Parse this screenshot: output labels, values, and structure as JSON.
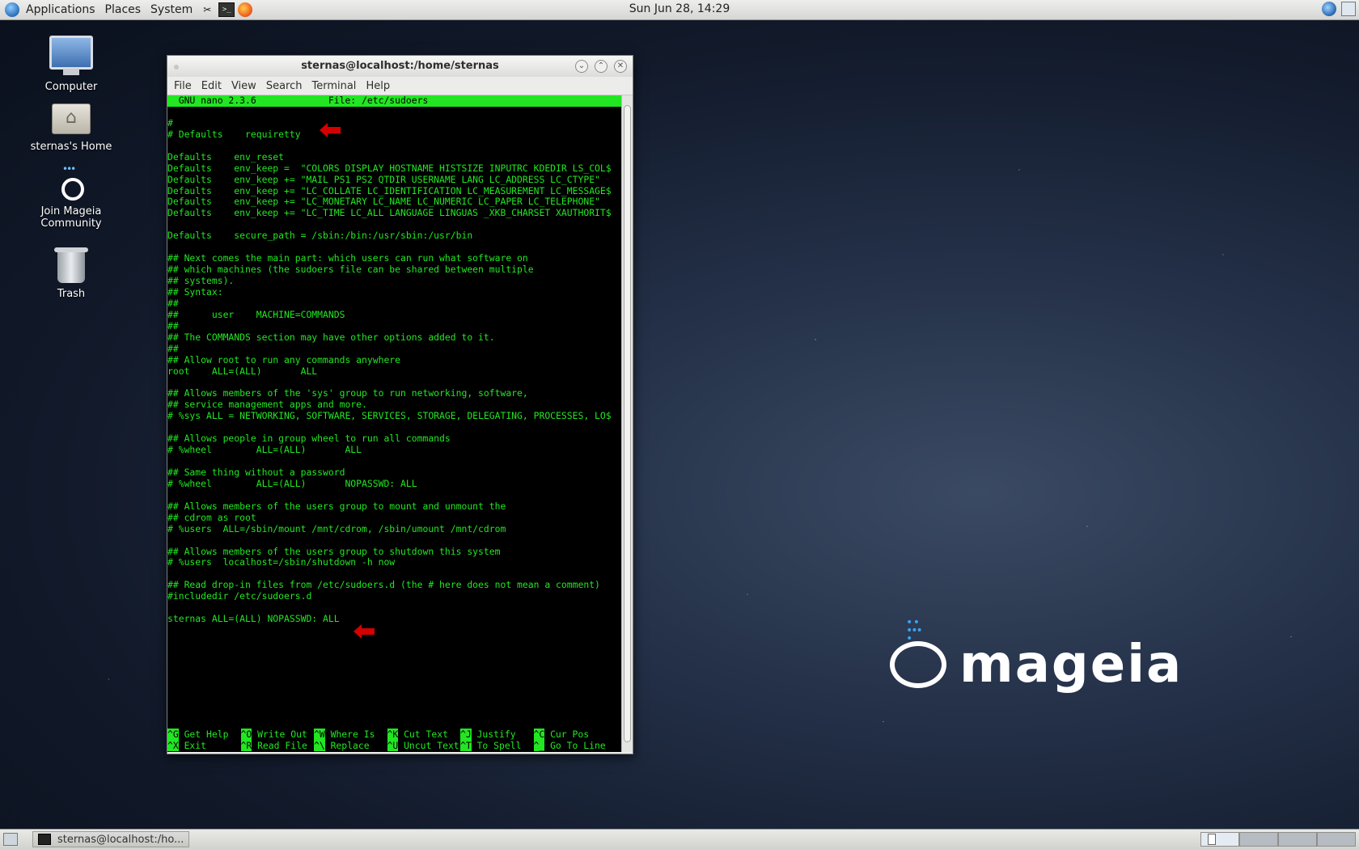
{
  "top_panel": {
    "menus": [
      "Applications",
      "Places",
      "System"
    ],
    "clock": "Sun Jun 28, 14:29"
  },
  "desktop_icons": [
    {
      "label": "Computer",
      "icon": "computer-icon"
    },
    {
      "label": "sternas's Home",
      "icon": "home-folder-icon"
    },
    {
      "label": "Join Mageia Community",
      "icon": "mageia-community-icon"
    },
    {
      "label": "Trash",
      "icon": "trash-icon"
    }
  ],
  "logo": {
    "text": "mageia"
  },
  "window": {
    "title": "sternas@localhost:/home/sternas",
    "menu": [
      "File",
      "Edit",
      "View",
      "Search",
      "Terminal",
      "Help"
    ]
  },
  "nano": {
    "header": "  GNU nano 2.3.6             File: /etc/sudoers",
    "lines": [
      "",
      "#",
      "# Defaults    requiretty",
      "",
      "Defaults    env_reset",
      "Defaults    env_keep =  \"COLORS DISPLAY HOSTNAME HISTSIZE INPUTRC KDEDIR LS_COL$",
      "Defaults    env_keep += \"MAIL PS1 PS2 QTDIR USERNAME LANG LC_ADDRESS LC_CTYPE\"",
      "Defaults    env_keep += \"LC_COLLATE LC_IDENTIFICATION LC_MEASUREMENT LC_MESSAGE$",
      "Defaults    env_keep += \"LC_MONETARY LC_NAME LC_NUMERIC LC_PAPER LC_TELEPHONE\"",
      "Defaults    env_keep += \"LC_TIME LC_ALL LANGUAGE LINGUAS _XKB_CHARSET XAUTHORIT$",
      "",
      "Defaults    secure_path = /sbin:/bin:/usr/sbin:/usr/bin",
      "",
      "## Next comes the main part: which users can run what software on",
      "## which machines (the sudoers file can be shared between multiple",
      "## systems).",
      "## Syntax:",
      "##",
      "##      user    MACHINE=COMMANDS",
      "##",
      "## The COMMANDS section may have other options added to it.",
      "##",
      "## Allow root to run any commands anywhere",
      "root    ALL=(ALL)       ALL",
      "",
      "## Allows members of the 'sys' group to run networking, software,",
      "## service management apps and more.",
      "# %sys ALL = NETWORKING, SOFTWARE, SERVICES, STORAGE, DELEGATING, PROCESSES, LO$",
      "",
      "## Allows people in group wheel to run all commands",
      "# %wheel        ALL=(ALL)       ALL",
      "",
      "## Same thing without a password",
      "# %wheel        ALL=(ALL)       NOPASSWD: ALL",
      "",
      "## Allows members of the users group to mount and unmount the",
      "## cdrom as root",
      "# %users  ALL=/sbin/mount /mnt/cdrom, /sbin/umount /mnt/cdrom",
      "",
      "## Allows members of the users group to shutdown this system",
      "# %users  localhost=/sbin/shutdown -h now",
      "",
      "## Read drop-in files from /etc/sudoers.d (the # here does not mean a comment)",
      "#includedir /etc/sudoers.d",
      "",
      "sternas ALL=(ALL) NOPASSWD: ALL"
    ],
    "shortcuts_row1": [
      {
        "key": "^G",
        "label": " Get Help"
      },
      {
        "key": "^O",
        "label": " Write Out"
      },
      {
        "key": "^W",
        "label": " Where Is"
      },
      {
        "key": "^K",
        "label": " Cut Text"
      },
      {
        "key": "^J",
        "label": " Justify"
      },
      {
        "key": "^C",
        "label": " Cur Pos"
      }
    ],
    "shortcuts_row2": [
      {
        "key": "^X",
        "label": " Exit"
      },
      {
        "key": "^R",
        "label": " Read File"
      },
      {
        "key": "^\\",
        "label": " Replace"
      },
      {
        "key": "^U",
        "label": " Uncut Text"
      },
      {
        "key": "^T",
        "label": " To Spell"
      },
      {
        "key": "^_",
        "label": " Go To Line"
      }
    ]
  },
  "taskbar": {
    "task_label": "sternas@localhost:/ho..."
  },
  "colors": {
    "terminal_fg": "#22e622",
    "terminal_bg": "#000000",
    "annotation_arrow": "#d40000"
  }
}
